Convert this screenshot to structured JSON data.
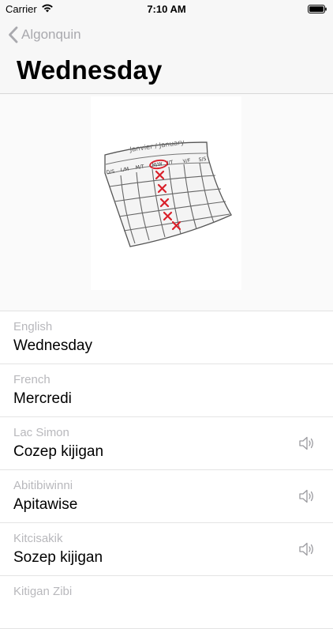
{
  "status_bar": {
    "carrier": "Carrier",
    "time": "7:10 AM",
    "icons": [
      "wifi-icon",
      "battery-icon"
    ]
  },
  "nav": {
    "back_label": "Algonquin",
    "back_icon": "chevron-left-icon",
    "title": "Wednesday"
  },
  "illustration": {
    "calendar_header": "Janvier / January",
    "days": [
      "D/S",
      "L/M",
      "M/T",
      "M/W",
      "J/T",
      "V/F",
      "S/S"
    ]
  },
  "translations": [
    {
      "language": "English",
      "word": "Wednesday",
      "has_audio": false
    },
    {
      "language": "French",
      "word": "Mercredi",
      "has_audio": false
    },
    {
      "language": "Lac Simon",
      "word": "Cozep kijigan",
      "has_audio": true
    },
    {
      "language": "Abitibiwinni",
      "word": "Apitawise",
      "has_audio": true
    },
    {
      "language": "Kitcisakik",
      "word": "Sozep kijigan",
      "has_audio": true
    },
    {
      "language": "Kitigan Zibi",
      "word": "",
      "has_audio": false
    }
  ],
  "colors": {
    "nav_background": "#f7f7f7",
    "secondary_text": "#b8b8bc",
    "back_tint": "#a9a9ae",
    "mark_red": "#d9202a"
  }
}
